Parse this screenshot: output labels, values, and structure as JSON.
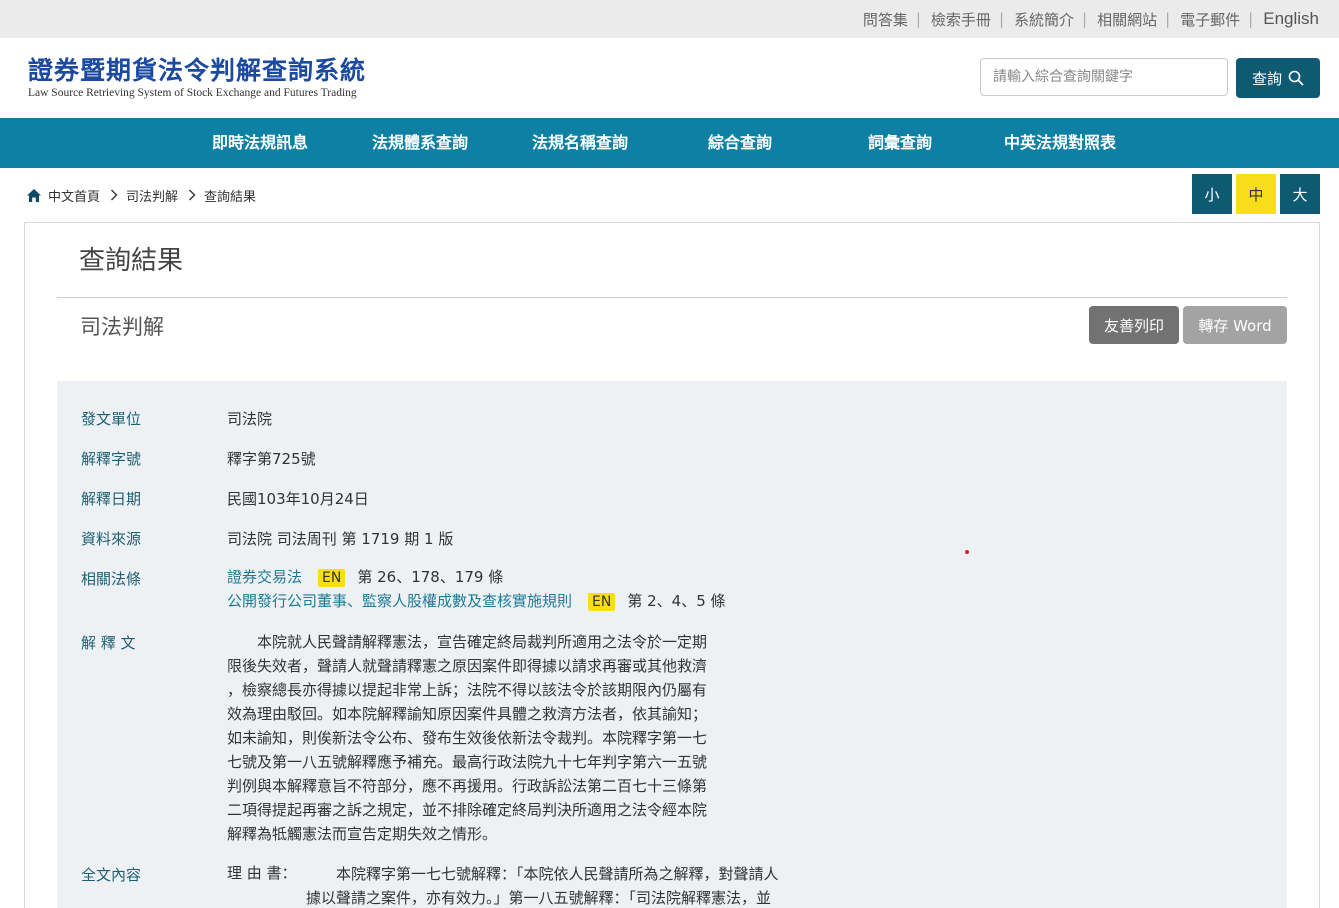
{
  "topbar": {
    "links": [
      "問答集",
      "檢索手冊",
      "系統簡介",
      "相關網站",
      "電子郵件"
    ],
    "english": "English"
  },
  "header": {
    "logo_cn": "證券暨期貨法令判解查詢系統",
    "logo_en": "Law Source Retrieving System of Stock Exchange and Futures Trading",
    "search_placeholder": "請輸入綜合查詢關鍵字",
    "search_button": "查詢"
  },
  "nav": {
    "items": [
      "即時法規訊息",
      "法規體系查詢",
      "法規名稱查詢",
      "綜合查詢",
      "詞彙查詢",
      "中英法規對照表"
    ]
  },
  "breadcrumb": [
    "中文首頁",
    "司法判解",
    "查詢結果"
  ],
  "font_size": {
    "small": "小",
    "medium": "中",
    "large": "大"
  },
  "page": {
    "title": "查詢結果",
    "section": "司法判解",
    "print_button": "友善列印",
    "word_button": "轉存 Word"
  },
  "fields": {
    "issuer_label": "發文單位",
    "issuer": "司法院",
    "number_label": "解釋字號",
    "number": "釋字第725號",
    "date_label": "解釋日期",
    "date": "民國103年10月24日",
    "source_label": "資料來源",
    "source": "司法院 司法周刊 第 1719 期 1 版",
    "related_label": "相關法條",
    "related": [
      {
        "law": "證券交易法",
        "badge": "EN",
        "articles": "第 26、178、179 條"
      },
      {
        "law": "公開發行公司董事、監察人股權成數及查核實施規則",
        "badge": "EN",
        "articles": "第 2、4、5 條"
      }
    ],
    "text_label": "解 釋 文",
    "text_lines": [
      "　　本院就人民聲請解釋憲法，宣告確定終局裁判所適用之法令於一定期",
      "限後失效者，聲請人就聲請釋憲之原因案件即得據以請求再審或其他救濟",
      "，檢察總長亦得據以提起非常上訴；法院不得以該法令於該期限內仍屬有",
      "效為理由駁回。如本院解釋諭知原因案件具體之救濟方法者，依其諭知；",
      "如未諭知，則俟新法令公布、發布生效後依新法令裁判。本院釋字第一七",
      "七號及第一八五號解釋應予補充。最高行政法院九十七年判字第六一五號",
      "判例與本解釋意旨不符部分，應不再援用。行政訴訟法第二百七十三條第",
      "二項得提起再審之訴之規定，並不排除確定終局判決所適用之法令經本院",
      "解釋為牴觸憲法而宣告定期失效之情形。"
    ],
    "full_label": "全文內容",
    "full_prefix": "理 由 書：",
    "full_lines": [
      "　　本院釋字第一七七號解釋：「本院依人民聲請所為之解釋，對聲請人",
      "據以聲請之案件，亦有效力。」第一八五號解釋：「司法院解釋憲法，並"
    ]
  }
}
